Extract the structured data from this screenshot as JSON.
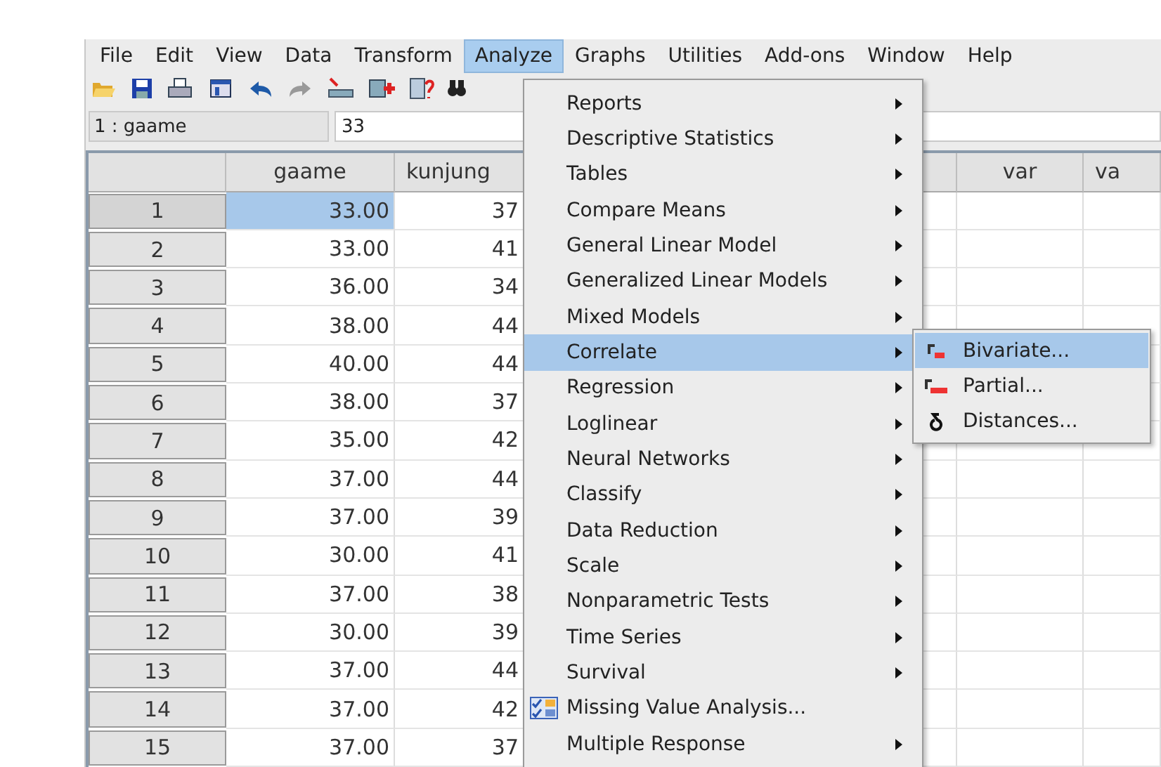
{
  "menu_bar": [
    {
      "label": "File",
      "selected": false
    },
    {
      "label": "Edit",
      "selected": false
    },
    {
      "label": "View",
      "selected": false
    },
    {
      "label": "Data",
      "selected": false
    },
    {
      "label": "Transform",
      "selected": false
    },
    {
      "label": "Analyze",
      "selected": true
    },
    {
      "label": "Graphs",
      "selected": false
    },
    {
      "label": "Utilities",
      "selected": false
    },
    {
      "label": "Add-ons",
      "selected": false
    },
    {
      "label": "Window",
      "selected": false
    },
    {
      "label": "Help",
      "selected": false
    }
  ],
  "cell_editor": {
    "cell": "1 : gaame",
    "value": "33"
  },
  "table": {
    "columns": [
      "gaame",
      "kunjung",
      "",
      "var",
      "va"
    ],
    "rows": [
      {
        "label": "1",
        "cells": [
          "33.00",
          "37"
        ],
        "selected": true
      },
      {
        "label": "2",
        "cells": [
          "33.00",
          "41"
        ],
        "selected": false
      },
      {
        "label": "3",
        "cells": [
          "36.00",
          "34"
        ],
        "selected": false
      },
      {
        "label": "4",
        "cells": [
          "38.00",
          "44"
        ],
        "selected": false
      },
      {
        "label": "5",
        "cells": [
          "40.00",
          "44"
        ],
        "selected": false
      },
      {
        "label": "6",
        "cells": [
          "38.00",
          "37"
        ],
        "selected": false
      },
      {
        "label": "7",
        "cells": [
          "35.00",
          "42"
        ],
        "selected": false
      },
      {
        "label": "8",
        "cells": [
          "37.00",
          "44"
        ],
        "selected": false
      },
      {
        "label": "9",
        "cells": [
          "37.00",
          "39"
        ],
        "selected": false
      },
      {
        "label": "10",
        "cells": [
          "30.00",
          "41"
        ],
        "selected": false
      },
      {
        "label": "11",
        "cells": [
          "37.00",
          "38"
        ],
        "selected": false
      },
      {
        "label": "12",
        "cells": [
          "30.00",
          "39"
        ],
        "selected": false
      },
      {
        "label": "13",
        "cells": [
          "37.00",
          "44"
        ],
        "selected": false
      },
      {
        "label": "14",
        "cells": [
          "37.00",
          "42"
        ],
        "selected": false
      },
      {
        "label": "15",
        "cells": [
          "37.00",
          "37"
        ],
        "selected": false
      }
    ]
  },
  "analyze_menu": [
    {
      "label": "Reports",
      "kind": "submenu",
      "selected": false
    },
    {
      "label": "Descriptive Statistics",
      "kind": "submenu",
      "selected": false
    },
    {
      "label": "Tables",
      "kind": "submenu",
      "selected": false
    },
    {
      "label": "Compare Means",
      "kind": "submenu",
      "selected": false
    },
    {
      "label": "General Linear Model",
      "kind": "submenu",
      "selected": false
    },
    {
      "label": "Generalized Linear Models",
      "kind": "submenu",
      "selected": false
    },
    {
      "label": "Mixed Models",
      "kind": "submenu",
      "selected": false
    },
    {
      "label": "Correlate",
      "kind": "submenu",
      "selected": true
    },
    {
      "label": "Regression",
      "kind": "submenu",
      "selected": false
    },
    {
      "label": "Loglinear",
      "kind": "submenu",
      "selected": false
    },
    {
      "label": "Neural Networks",
      "kind": "submenu",
      "selected": false
    },
    {
      "label": "Classify",
      "kind": "submenu",
      "selected": false
    },
    {
      "label": "Data Reduction",
      "kind": "submenu",
      "selected": false
    },
    {
      "label": "Scale",
      "kind": "submenu",
      "selected": false
    },
    {
      "label": "Nonparametric Tests",
      "kind": "submenu",
      "selected": false
    },
    {
      "label": "Time Series",
      "kind": "submenu",
      "selected": false
    },
    {
      "label": "Survival",
      "kind": "submenu",
      "selected": false
    },
    {
      "label": "Missing Value Analysis...",
      "kind": "action",
      "selected": false
    },
    {
      "label": "Multiple Response",
      "kind": "submenu",
      "selected": false
    }
  ],
  "correlate_submenu": [
    {
      "label": "Bivariate...",
      "kind": "bivariate",
      "selected": true
    },
    {
      "label": "Partial...",
      "kind": "partial",
      "selected": false
    },
    {
      "label": "Distances...",
      "kind": "distances",
      "selected": false
    }
  ]
}
